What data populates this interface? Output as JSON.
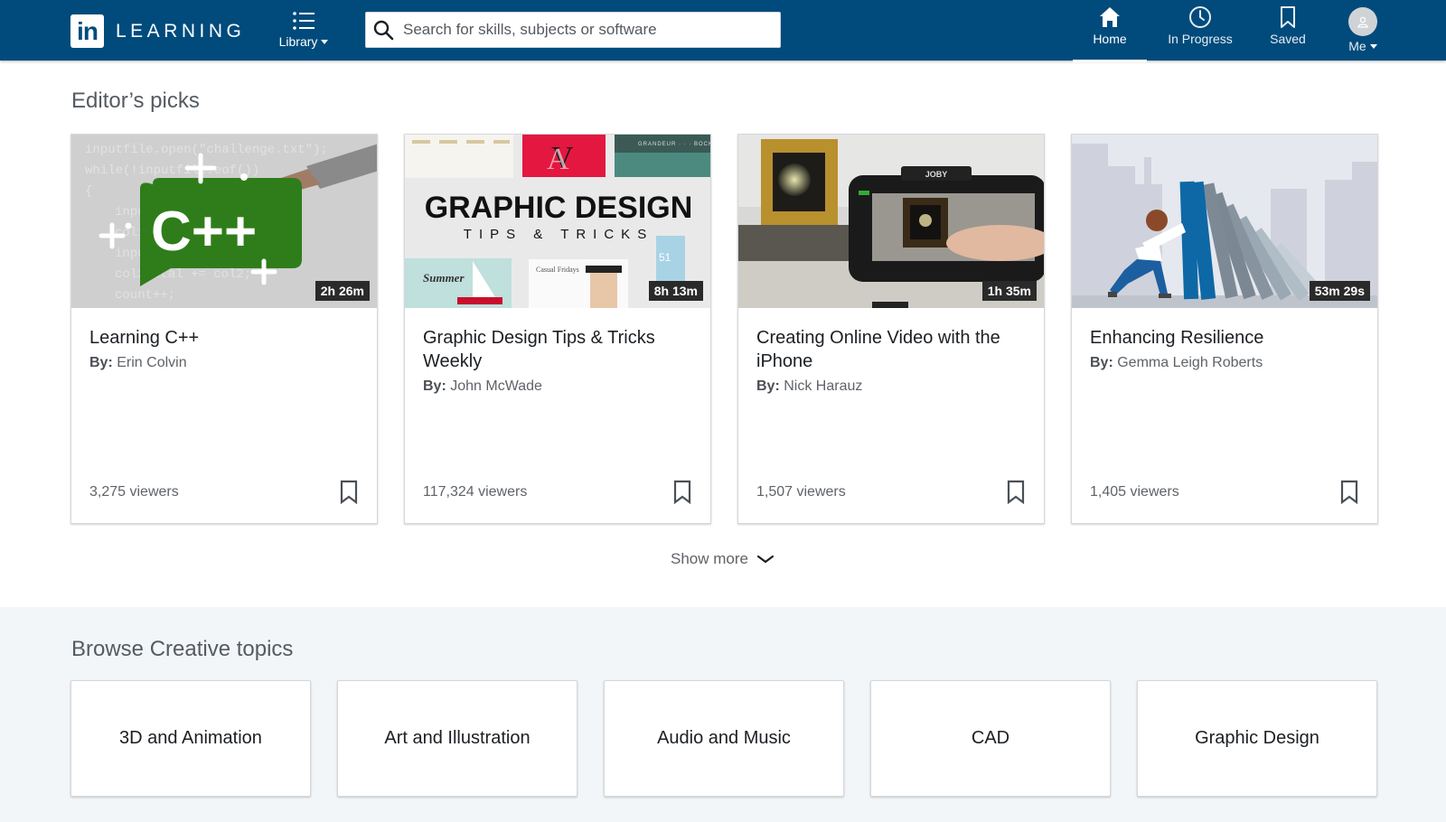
{
  "header": {
    "logo_mark": "in",
    "logo_text": "LEARNING",
    "library_label": "Library",
    "search_placeholder": "Search for skills, subjects or software",
    "search_value": "",
    "nav": [
      {
        "label": "Home",
        "icon": "home-icon",
        "active": true
      },
      {
        "label": "In Progress",
        "icon": "clock-icon",
        "active": false
      },
      {
        "label": "Saved",
        "icon": "bookmark-icon",
        "active": false
      },
      {
        "label": "Me",
        "icon": "avatar-icon",
        "active": false
      }
    ]
  },
  "editors_picks": {
    "title": "Editor’s picks",
    "author_prefix": "By:",
    "courses": [
      {
        "title": "Learning C++",
        "author": "Erin Colvin",
        "duration": "2h 26m",
        "viewers": "3,275 viewers",
        "thumb_text": "C++"
      },
      {
        "title": "Graphic Design Tips & Tricks Weekly",
        "author": "John McWade",
        "duration": "8h 13m",
        "viewers": "117,324 viewers",
        "thumb_text": "GRAPHIC DESIGN",
        "thumb_subtext": "TIPS & TRICKS"
      },
      {
        "title": "Creating Online Video with the iPhone",
        "author": "Nick Harauz",
        "duration": "1h 35m",
        "viewers": "1,507 viewers",
        "thumb_text": "JOBY"
      },
      {
        "title": "Enhancing Resilience",
        "author": "Gemma Leigh Roberts",
        "duration": "53m 29s",
        "viewers": "1,405 viewers"
      }
    ],
    "show_more_label": "Show more"
  },
  "browse": {
    "title": "Browse Creative topics",
    "topics": [
      "3D and Animation",
      "Art and Illustration",
      "Audio and Music",
      "CAD",
      "Graphic Design"
    ]
  },
  "colors": {
    "header_bg": "#004b7c",
    "browse_bg": "#f3f6f8",
    "cpp_green": "#2e7d1a"
  }
}
